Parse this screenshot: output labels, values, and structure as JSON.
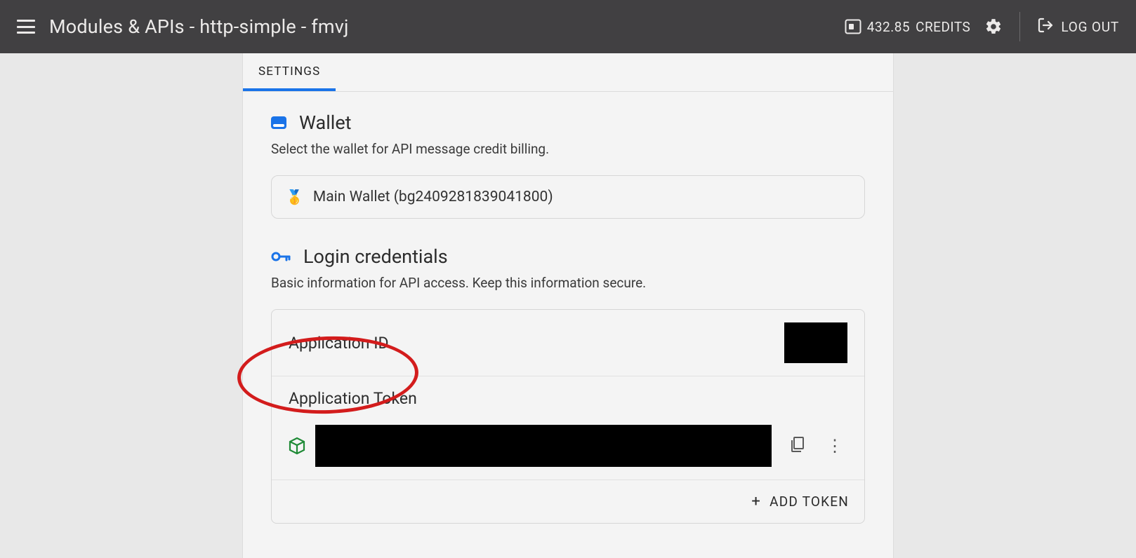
{
  "header": {
    "title": "Modules & APIs - http-simple - fmvj",
    "credits_value": "432.85",
    "credits_label": "CREDITS",
    "logout_label": "LOG OUT"
  },
  "tabs": {
    "active": "SETTINGS"
  },
  "wallet": {
    "title": "Wallet",
    "desc": "Select the wallet for API message credit billing.",
    "selected": "Main Wallet (bg2409281839041800)",
    "medal_emoji": "🥇"
  },
  "creds": {
    "title": "Login credentials",
    "desc": "Basic information for API access. Keep this information secure.",
    "app_id_label": "Application ID",
    "app_token_label": "Application Token",
    "add_token_label": "ADD TOKEN"
  },
  "annotation": {
    "highlight": "Application Token"
  }
}
